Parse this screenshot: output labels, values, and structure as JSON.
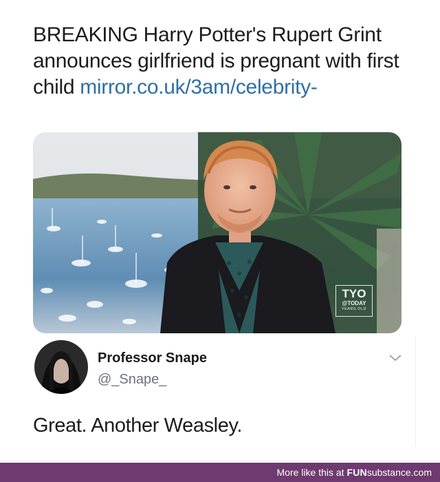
{
  "headline": {
    "text": "BREAKING Harry Potter's Rupert Grint announces girlfriend is pregnant with first child ",
    "link": "mirror.co.uk/3am/celebrity-"
  },
  "photo": {
    "watermark_big": "TYO",
    "watermark_mid": "@TODAY",
    "watermark_small": "YEARS OLD"
  },
  "tweet": {
    "display_name": "Professor Snape",
    "handle": "@_Snape_",
    "text": "Great. Another Weasley.",
    "menu_icon": "chevron-down-icon"
  },
  "footer": {
    "prefix": "More like this at ",
    "brand_fun": "FUN",
    "brand_rest": "substance.com",
    "background": "#6e3a6f"
  }
}
